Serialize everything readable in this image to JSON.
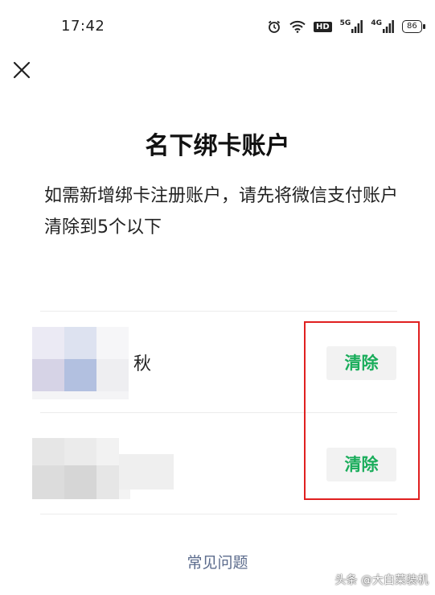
{
  "status_bar": {
    "time": "17:42",
    "hd_label": "HD",
    "network_1": "5G",
    "network_2": "4G",
    "battery": "86"
  },
  "page": {
    "title": "名下绑卡账户",
    "description": "如需新增绑卡注册账户，请先将微信支付账户清除到5个以下"
  },
  "accounts": [
    {
      "name": "秋",
      "action_label": "清除"
    },
    {
      "name": "",
      "action_label": "清除"
    }
  ],
  "footer": {
    "faq_link": "常见问题",
    "watermark": "头条 @大白菜装机"
  },
  "colors": {
    "accent_green": "#1aad5b",
    "link_blue": "#5b6b8c",
    "highlight_red": "#e02020"
  }
}
